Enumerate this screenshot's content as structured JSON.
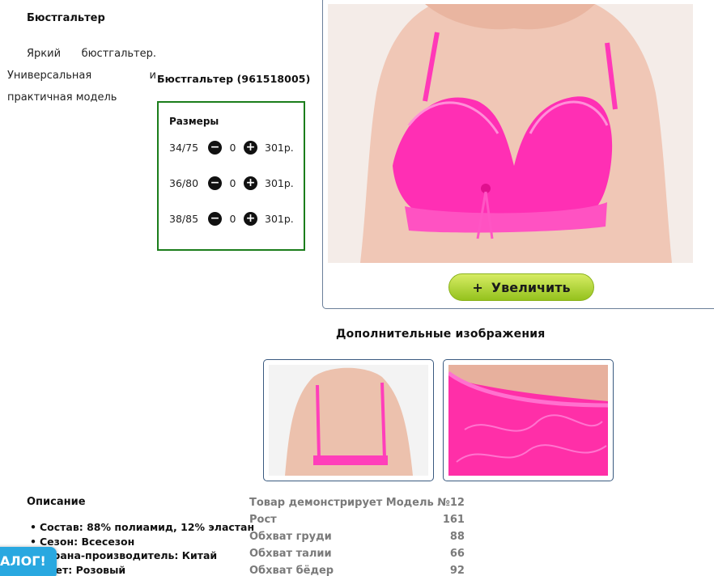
{
  "product": {
    "title": "Бюстгальтер",
    "description_line1": "Яркий бюстгальтер.",
    "description_line2": "Универсальная и",
    "description_line3": "практичная модель",
    "sku_title": "Бюстгальтер (961518005)"
  },
  "sizes": {
    "heading": "Размеры",
    "rows": [
      {
        "size": "34/75",
        "qty": "0",
        "price": "301р."
      },
      {
        "size": "36/80",
        "qty": "0",
        "price": "301р."
      },
      {
        "size": "38/85",
        "qty": "0",
        "price": "301р."
      }
    ]
  },
  "gallery": {
    "zoom_plus": "+",
    "zoom_label": "Увеличить",
    "extra_heading": "Дополнительные изображения"
  },
  "description": {
    "heading": "Описание",
    "items": [
      "Состав: 88% полиамид, 12% эластан",
      "Сезон: Всесезон",
      "Страна-производитель: Китай",
      "Цвет: Розовый"
    ]
  },
  "model": {
    "heading": "Товар демонстрирует Модель №12",
    "rows": [
      {
        "label": "Рост",
        "value": "161"
      },
      {
        "label": "Обхват груди",
        "value": "88"
      },
      {
        "label": "Обхват талии",
        "value": "66"
      },
      {
        "label": "Обхват бёдер",
        "value": "92"
      }
    ]
  },
  "catalog_tab": "АЛОГ!",
  "colors": {
    "sizes_border": "#1b7d1b",
    "zoom_button": "#a8cc2a",
    "catalog_tab": "#29a8e0",
    "bra_pink": "#ff2fb4"
  },
  "icons": {
    "minus": "minus-circle-icon",
    "plus": "plus-circle-icon"
  }
}
